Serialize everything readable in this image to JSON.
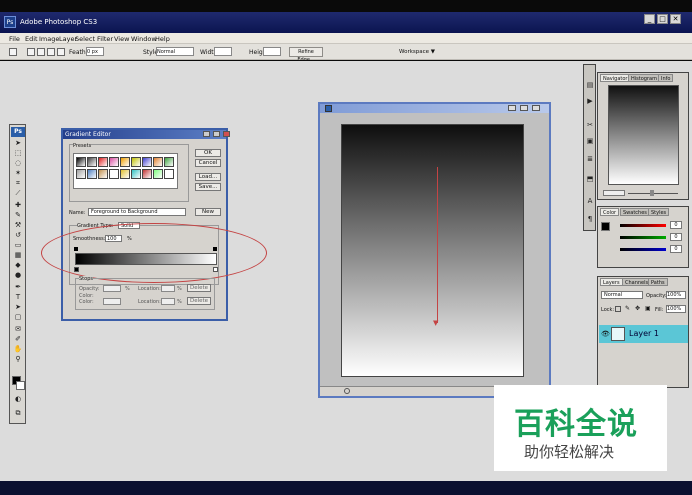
{
  "titlebar": {
    "app_title": "Adobe Photoshop CS3",
    "icon_label": "Ps"
  },
  "menu": [
    "File",
    "Edit",
    "Image",
    "Layer",
    "Select",
    "Filter",
    "View",
    "Window",
    "Help"
  ],
  "options_bar": {
    "feather_label": "Feather:",
    "feather_value": "0 px",
    "style_label": "Style:",
    "style_value": "Normal",
    "width_label": "Width:",
    "height_label": "Height:",
    "refine_edge": "Refine Edge...",
    "workspace": "Workspace ▼"
  },
  "toolbox": {
    "logo": "Ps"
  },
  "gradient_editor": {
    "title": "Gradient Editor",
    "presets_label": "Presets",
    "buttons": {
      "ok": "OK",
      "cancel": "Cancel",
      "load": "Load...",
      "save": "Save...",
      "new": "New",
      "delete": "Delete"
    },
    "name_label": "Name:",
    "name_value": "Foreground to Background",
    "gradient_type_label": "Gradient Type:",
    "gradient_type_value": "Solid",
    "smoothness_label": "Smoothness:",
    "smoothness_value": "100",
    "smoothness_unit": "%",
    "stops_label": "Stops",
    "opacity_label": "Opacity:",
    "color_label": "Color:",
    "location_label": "Location:",
    "percent": "%",
    "preset_colors": [
      "#000000",
      "#444444",
      "#e02020",
      "#d94fa0",
      "#f0a000",
      "#c0c000",
      "#4040d0",
      "#e08030",
      "#40a040",
      "#a0a0a0",
      "#5080c0",
      "#c09050",
      "#ffffff",
      "#e0c030",
      "#30c0c0",
      "#c03030",
      "#80ff80",
      "#ffffff"
    ]
  },
  "panels": {
    "navigator_tabs": [
      "Navigator",
      "Histogram",
      "Info"
    ],
    "color_tabs": [
      "Color",
      "Swatches",
      "Styles"
    ],
    "color_values": [
      "0",
      "0",
      "0"
    ],
    "layers_tabs": [
      "Layers",
      "Channels",
      "Paths"
    ],
    "blend_mode": "Normal",
    "opacity_label": "Opacity:",
    "opacity_value": "100%",
    "lock_label": "Lock:",
    "fill_label": "Fill:",
    "fill_value": "100%",
    "layer_name": "Layer 1"
  },
  "watermark": {
    "title": "百科全说",
    "subtitle": "助你轻松解决"
  },
  "colors": {
    "accent": "#1aa05a",
    "title_bar": "#0b1450",
    "layer_selected": "#5bc6d6",
    "annotation": "#c44444"
  }
}
